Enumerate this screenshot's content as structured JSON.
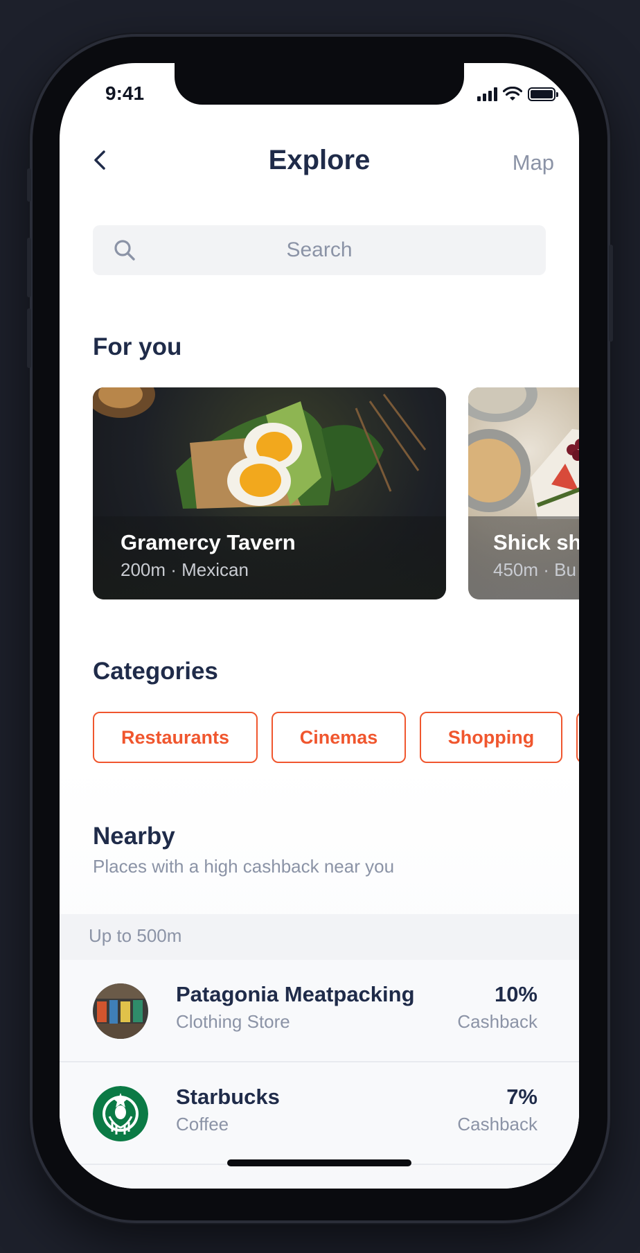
{
  "status_bar": {
    "time": "9:41"
  },
  "nav": {
    "title": "Explore",
    "map_label": "Map"
  },
  "search": {
    "placeholder": "Search"
  },
  "for_you": {
    "title": "For you",
    "cards": [
      {
        "name": "Gramercy Tavern",
        "meta": "200m · Mexican"
      },
      {
        "name": "Shick sh",
        "meta": "450m · Bu"
      }
    ]
  },
  "categories": {
    "title": "Categories",
    "items": [
      {
        "label": "Restaurants"
      },
      {
        "label": "Cinemas"
      },
      {
        "label": "Shopping"
      }
    ]
  },
  "nearby": {
    "title": "Nearby",
    "subtitle": "Places with a high cashback near you",
    "group_label": "Up to 500m",
    "places": [
      {
        "name": "Patagonia Meatpacking",
        "type": "Clothing Store",
        "cashback_pct": "10%",
        "cashback_label": "Cashback"
      },
      {
        "name": "Starbucks",
        "type": "Coffee",
        "cashback_pct": "7%",
        "cashback_label": "Cashback"
      }
    ]
  },
  "colors": {
    "accent": "#f0562e",
    "heading": "#1f2b49",
    "muted": "#8b93a6"
  },
  "icons": {
    "back": "chevron-left-icon",
    "search": "search-icon"
  }
}
